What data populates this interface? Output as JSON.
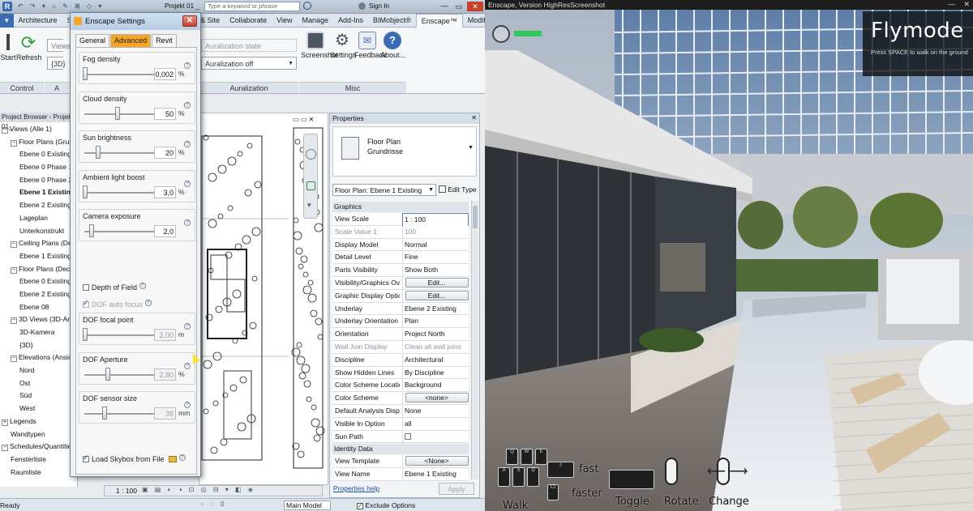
{
  "revit": {
    "title_bar": {
      "search_placeholder": "Type a keyword or phrase",
      "project_tab": "Projekt 01 _",
      "sign_in": "Sign In"
    },
    "menu_tabs": [
      "Architecture",
      "St",
      "& Site",
      "Collaborate",
      "View",
      "Manage",
      "Add-Ins",
      "BIMobject®",
      "Enscape™",
      "Modify"
    ],
    "ribbon": {
      "start_label": "Start",
      "refresh_label": "Refresh",
      "views_field": "Views o",
      "view_3d": "{3D}",
      "auralization_state": "Auralization state",
      "auralization_value": "Auralization off",
      "screenshot": "Screenshot",
      "settings": "Settings",
      "feedback": "Feedback",
      "about": "About...",
      "groups": {
        "control": "Control",
        "a": "A",
        "auralization": "Auralization",
        "misc": "Misc"
      }
    },
    "project_browser": {
      "header": "Project Browser - Projekt 01_",
      "items": [
        {
          "label": "Views (Alle 1)",
          "level": 0,
          "sign": "−"
        },
        {
          "label": "Floor Plans (Grundri",
          "level": 1,
          "sign": "−"
        },
        {
          "label": "Ebene 0 Existing",
          "level": 2
        },
        {
          "label": "Ebene 0 Phase 1",
          "level": 2
        },
        {
          "label": "Ebene 0 Phase 2",
          "level": 2
        },
        {
          "label": "Ebene 1 Existing",
          "level": 2,
          "bold": true
        },
        {
          "label": "Ebene 2 Existing",
          "level": 2
        },
        {
          "label": "Lageplan",
          "level": 2
        },
        {
          "label": "Unterkonstrukt",
          "level": 2
        },
        {
          "label": "Ceiling Plans (Decke",
          "level": 1,
          "sign": "−"
        },
        {
          "label": "Ebene 1 Existing",
          "level": 2
        },
        {
          "label": "Floor Plans (Decke",
          "level": 1,
          "sign": "−"
        },
        {
          "label": "Ebene 0 Existing",
          "level": 2
        },
        {
          "label": "Ebene 2 Existing",
          "level": 2
        },
        {
          "label": "Ebene 08",
          "level": 2
        },
        {
          "label": "3D Views (3D-Ansicht",
          "level": 1,
          "sign": "−"
        },
        {
          "label": "3D-Kamera",
          "level": 2
        },
        {
          "label": "{3D}",
          "level": 2
        },
        {
          "label": "Elevations (Ansicht)",
          "level": 1,
          "sign": "−"
        },
        {
          "label": "Nord",
          "level": 2
        },
        {
          "label": "Ost",
          "level": 2
        },
        {
          "label": "Süd",
          "level": 2
        },
        {
          "label": "West",
          "level": 2
        },
        {
          "label": "Legends",
          "level": 0,
          "sign": "+"
        },
        {
          "label": "Wandtypen",
          "level": 1
        },
        {
          "label": "Schedules/Quantities",
          "level": 0,
          "sign": "−"
        },
        {
          "label": "Fensterliste",
          "level": 1
        },
        {
          "label": "Raumliste",
          "level": 1
        }
      ]
    },
    "properties": {
      "header": "Properties",
      "family": "Floor Plan",
      "type": "Grundrisse",
      "selector": "Floor Plan: Ebene 1 Existing",
      "edit_type": "Edit Type",
      "graphics_section": "Graphics",
      "identity_section": "Identity Data",
      "rows": [
        {
          "k": "View Scale",
          "v": "1 : 100",
          "input": true
        },
        {
          "k": "Scale Value    1:",
          "v": "100",
          "dim": true
        },
        {
          "k": "Display Model",
          "v": "Normal"
        },
        {
          "k": "Detail Level",
          "v": "Fine"
        },
        {
          "k": "Parts Visibility",
          "v": "Show Both"
        },
        {
          "k": "Visibility/Graphics Over...",
          "v": "Edit...",
          "button": true
        },
        {
          "k": "Graphic Display Options",
          "v": "Edit...",
          "button": true
        },
        {
          "k": "Underlay",
          "v": "Ebene 2 Existing"
        },
        {
          "k": "Underlay Orientation",
          "v": "Plan"
        },
        {
          "k": "Orientation",
          "v": "Project North"
        },
        {
          "k": "Wall Join Display",
          "v": "Clean all wall joins",
          "dim": true
        },
        {
          "k": "Discipline",
          "v": "Architectural"
        },
        {
          "k": "Show Hidden Lines",
          "v": "By Discipline"
        },
        {
          "k": "Color Scheme Location",
          "v": "Background"
        },
        {
          "k": "Color Scheme",
          "v": "<none>",
          "button": true
        },
        {
          "k": "Default Analysis Displa...",
          "v": "None"
        },
        {
          "k": "Visible In Option",
          "v": "all"
        },
        {
          "k": "Sun Path",
          "v": "",
          "checkbox": true
        }
      ],
      "identity_rows": [
        {
          "k": "View Template",
          "v": "<None>",
          "button": true
        },
        {
          "k": "View Name",
          "v": "Ebene 1 Existing"
        }
      ],
      "help_link": "Properties help",
      "apply": "Apply"
    },
    "view_bar": {
      "scale": "1 : 100"
    },
    "status_bar": {
      "left": "Ready",
      "model": "Main Model",
      "exclude": "Exclude Options"
    }
  },
  "enscape_dialog": {
    "title": "Enscape Settings",
    "tabs": [
      "General",
      "Advanced",
      "Revit"
    ],
    "active_tab": "Advanced",
    "sliders_top": [
      {
        "label": "Fog density",
        "value": "0,002",
        "unit": "%",
        "level": 0.0
      },
      {
        "label": "Cloud density",
        "value": "50",
        "unit": "%",
        "level": 0.5
      },
      {
        "label": "Sun brightness",
        "value": "20",
        "unit": "%",
        "level": 0.2
      },
      {
        "label": "Ambient light boost",
        "value": "3,0",
        "unit": "%",
        "level": 0.0
      },
      {
        "label": "Camera exposure",
        "value": "2,0",
        "unit": "",
        "level": 0.1
      }
    ],
    "depth_of_field": "Depth of Field",
    "dof_auto_focus": "DOF auto focus",
    "sliders_bottom": [
      {
        "label": "DOF focal point",
        "value": "2,00",
        "unit": "m",
        "level": 0.0
      },
      {
        "label": "DOF Aperture",
        "value": "2,80",
        "unit": "%",
        "level": 0.35
      },
      {
        "label": "DOF sensor size",
        "value": "38",
        "unit": "mm",
        "level": 0.3
      }
    ],
    "load_skybox": "Load Skybox from File"
  },
  "render": {
    "title": "Enscape, Version HighResScreenshot",
    "mode": "Flymode",
    "hint": "Press SPACE to walk on the ground",
    "controls": {
      "walk": "Walk",
      "fast": "fast",
      "faster": "faster",
      "toggle": "Toggle",
      "rotate": "Rotate",
      "change": "Change"
    },
    "keys": {
      "q": "Q",
      "w": "W",
      "e": "E",
      "a": "A",
      "s": "S",
      "d": "D"
    }
  },
  "colors": {
    "enscape_accent": "#f6a623",
    "revit_chrome": "#dfe5ec",
    "close_red": "#c4432d"
  }
}
